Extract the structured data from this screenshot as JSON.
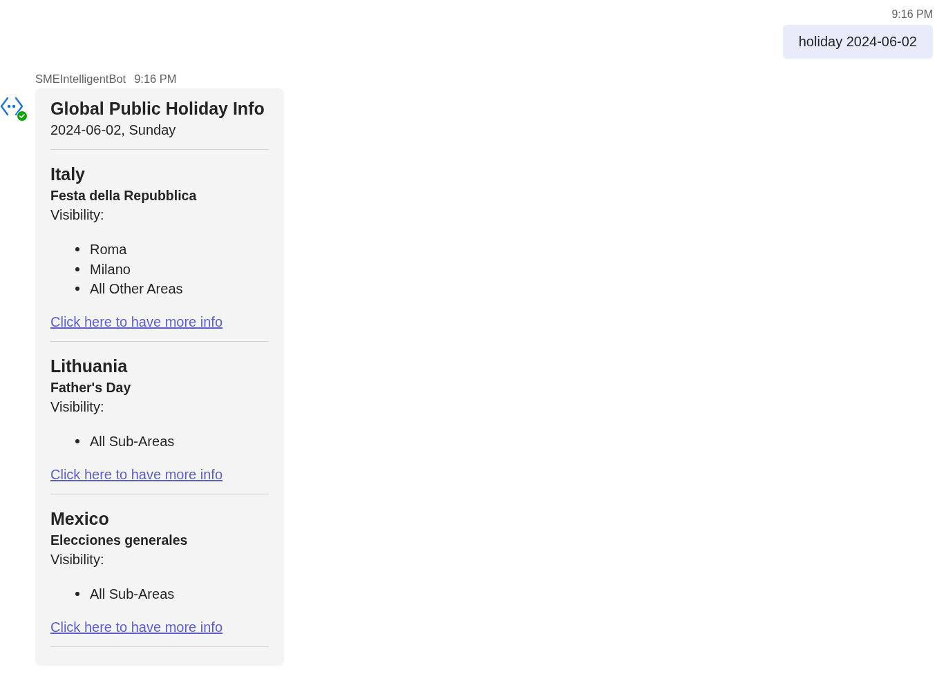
{
  "user_message": {
    "time": "9:16 PM",
    "text": "holiday 2024-06-02"
  },
  "bot_message": {
    "sender": "SMEIntelligentBot",
    "time": "9:16 PM",
    "card": {
      "title": "Global Public Holiday Info",
      "date": "2024-06-02, Sunday",
      "holidays": [
        {
          "country": "Italy",
          "holiday": "Festa della Repubblica",
          "visibility_label": "Visibility:",
          "areas": [
            "Roma",
            "Milano",
            "All Other Areas"
          ],
          "link": "Click here to have more info"
        },
        {
          "country": "Lithuania",
          "holiday": "Father's Day",
          "visibility_label": "Visibility:",
          "areas": [
            "All Sub-Areas"
          ],
          "link": "Click here to have more info"
        },
        {
          "country": "Mexico",
          "holiday": "Elecciones generales",
          "visibility_label": "Visibility:",
          "areas": [
            "All Sub-Areas"
          ],
          "link": "Click here to have more info"
        }
      ]
    }
  }
}
